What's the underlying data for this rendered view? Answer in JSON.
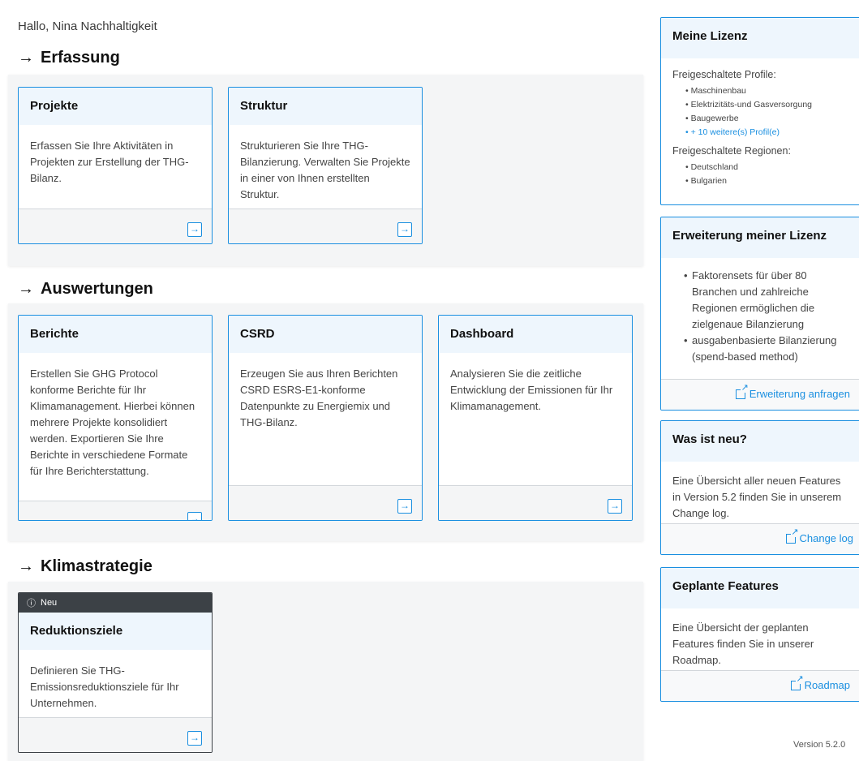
{
  "greeting": "Hallo, Nina Nachhaltigkeit",
  "sections": {
    "erfassung": {
      "title": "Erfassung"
    },
    "auswertungen": {
      "title": "Auswertungen"
    },
    "klimastrategie": {
      "title": "Klimastrategie"
    }
  },
  "cards": {
    "projekte": {
      "title": "Projekte",
      "text": "Erfassen Sie Ihre Aktivitäten in Projekten zur Erstellung der THG-Bilanz."
    },
    "struktur": {
      "title": "Struktur",
      "text": "Strukturieren Sie Ihre THG-Bilanzierung. Verwalten Sie Projekte in einer von Ihnen erstellten Struktur."
    },
    "berichte": {
      "title": "Berichte",
      "text": "Erstellen Sie GHG Protocol konforme Berichte für Ihr Klimamanagement. Hierbei können mehrere Projekte konsolidiert werden. Exportieren Sie Ihre Berichte in verschiedene Formate für Ihre Berichterstattung."
    },
    "csrd": {
      "title": "CSRD",
      "text": "Erzeugen Sie aus Ihren Berichten CSRD ESRS-E1-konforme Datenpunkte zu Energiemix und THG-Bilanz."
    },
    "dashboard": {
      "title": "Dashboard",
      "text": "Analysieren Sie die zeitliche Entwicklung der Emissionen für Ihr Klimamanagement."
    },
    "reduktionsziele": {
      "badge": "Neu",
      "title": "Reduktionsziele",
      "text": "Definieren Sie THG-Emissionsreduktionsziele für Ihr Unternehmen."
    }
  },
  "sidebar": {
    "lizenz": {
      "title": "Meine Lizenz",
      "profiles_label": "Freigeschaltete Profile:",
      "profiles": [
        "Maschinenbau",
        "Elektrizitäts-und Gasversorgung",
        "Baugewerbe"
      ],
      "more_profiles": "+ 10 weitere(s) Profil(e)",
      "regions_label": "Freigeschaltete Regionen:",
      "regions": [
        "Deutschland",
        "Bulgarien"
      ]
    },
    "erweiterung": {
      "title": "Erweiterung meiner Lizenz",
      "items": [
        "Faktorensets für über 80 Branchen und zahlreiche Regionen ermöglichen die zielgenaue Bilanzierung",
        "ausgabenbasierte Bilanzierung (spend-based method)"
      ],
      "link": "Erweiterung anfragen"
    },
    "neu": {
      "title": "Was ist neu?",
      "text": "Eine Übersicht aller neuen Features in Version 5.2 finden Sie in unserem Change log.",
      "link": "Change log"
    },
    "geplant": {
      "title": "Geplante Features",
      "text": "Eine Übersicht der geplanten Features finden Sie in unserer Roadmap.",
      "link": "Roadmap"
    }
  },
  "version": "Version 5.2.0",
  "icons": {
    "arrow": "→",
    "open": "→",
    "info": "ⓘ"
  },
  "colors": {
    "accent": "#1a8fe0",
    "card_head": "#eef6fd",
    "badge": "#3c4146"
  }
}
